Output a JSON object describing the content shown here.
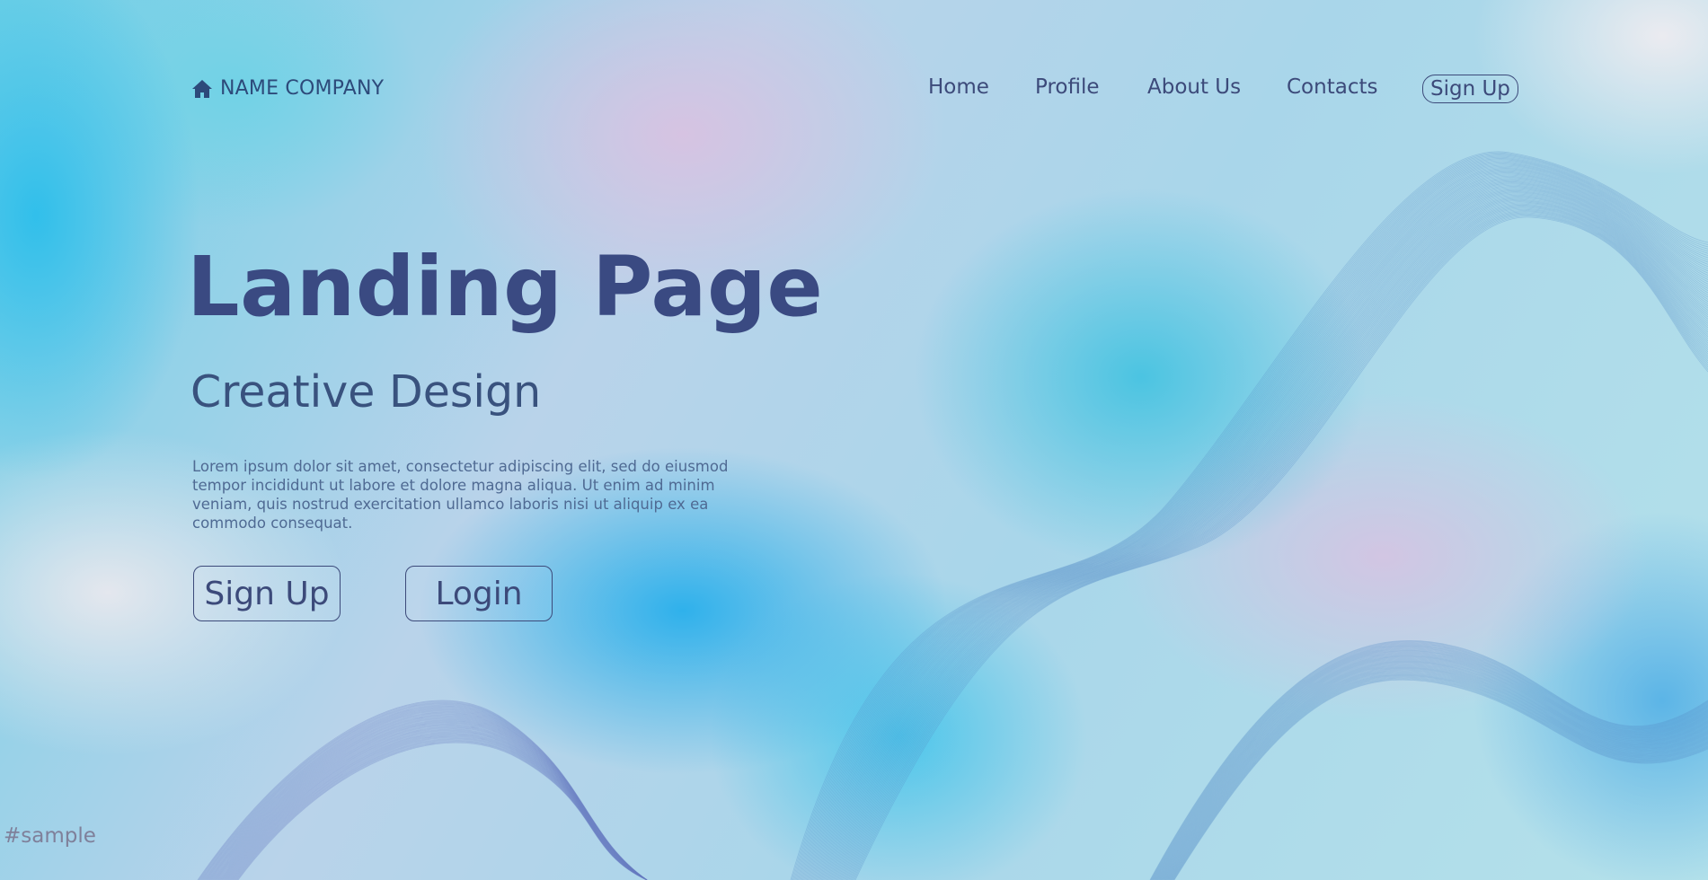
{
  "brand": {
    "icon": "home-icon",
    "name": "NAME COMPANY"
  },
  "nav": {
    "items": [
      {
        "label": "Home"
      },
      {
        "label": "Profile"
      },
      {
        "label": "About Us"
      },
      {
        "label": "Contacts"
      }
    ],
    "cta_label": "Sign Up"
  },
  "hero": {
    "title": "Landing Page",
    "subtitle": "Creative Design",
    "body": "Lorem ipsum dolor sit amet, consectetur adipiscing elit, sed do eiusmod tempor incididunt ut labore et dolore magna aliqua. Ut enim ad minim veniam, quis nostrud exercitation ullamco laboris nisi ut aliquip ex ea commodo consequat.",
    "buttons": {
      "signup_label": "Sign Up",
      "login_label": "Login"
    }
  },
  "watermark": "#sample",
  "colors": {
    "text_primary": "#3a4a82",
    "text_secondary": "#4f6a93",
    "accent_cyan": "#3cc3e8",
    "accent_lavender": "#d6c3e2"
  }
}
